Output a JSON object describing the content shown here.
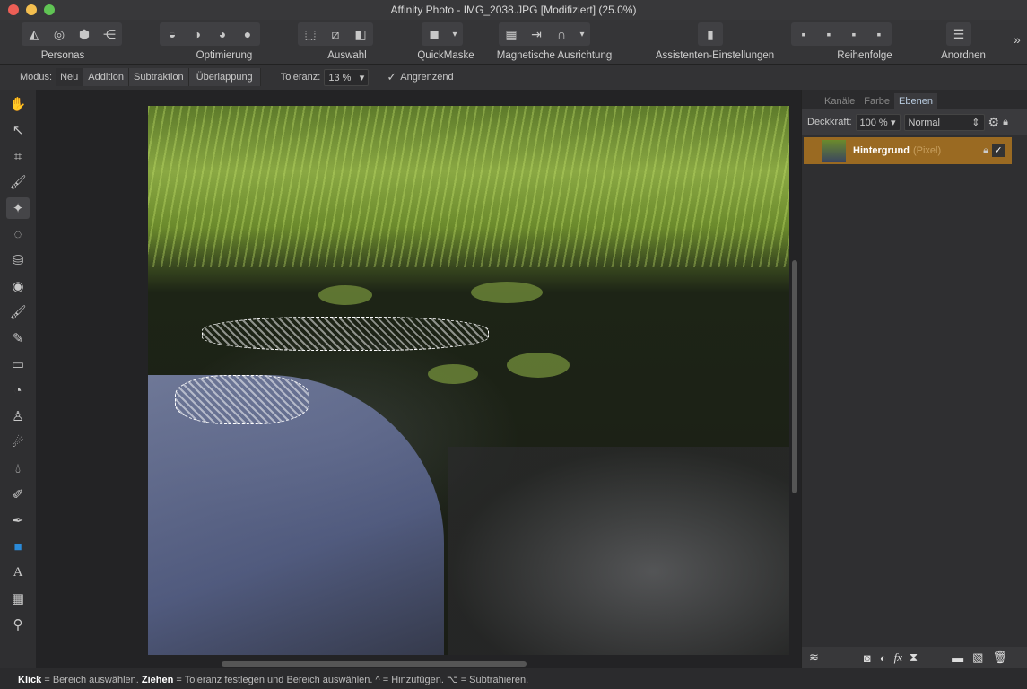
{
  "window": {
    "title": "Affinity Photo - IMG_2038.JPG [Modifiziert] (25.0%)"
  },
  "colors": {
    "accent": "#9a6a22",
    "tab_active": "#b9cce0",
    "close": "#ed5f56",
    "min": "#f4bf4f",
    "max": "#60c454"
  },
  "toolbar": {
    "groups": [
      {
        "label": "Personas",
        "icons": [
          "photo-persona-icon",
          "liquify-persona-icon",
          "develop-persona-icon",
          "export-persona-icon"
        ]
      },
      {
        "label": "Optimierung",
        "icons": [
          "auto-levels-icon",
          "auto-contrast-icon",
          "auto-colors-icon",
          "auto-white-balance-icon"
        ]
      },
      {
        "label": "Auswahl",
        "icons": [
          "select-all-icon",
          "deselect-icon",
          "invert-selection-icon"
        ]
      },
      {
        "label": "QuickMaske",
        "icons": [
          "quickmask-icon",
          "dropdown-icon"
        ]
      },
      {
        "label": "Magnetische Ausrichtung",
        "icons": [
          "snapping-grid-icon",
          "snapping-move-icon",
          "snapping-magnet-icon",
          "dropdown-icon"
        ]
      },
      {
        "label": "Assistenten-Einstellungen",
        "icons": [
          "assistant-icon"
        ]
      },
      {
        "label": "Reihenfolge",
        "icons": [
          "move-back-icon",
          "move-backward-icon",
          "move-forward-icon",
          "move-front-icon"
        ]
      },
      {
        "label": "Anordnen",
        "icons": [
          "align-icon"
        ]
      }
    ],
    "overflow": "»"
  },
  "context": {
    "mode_label": "Modus:",
    "modes": [
      "Neu",
      "Addition",
      "Subtraktion",
      "Überlappung"
    ],
    "tolerance_label": "Toleranz:",
    "tolerance_value": "13 %",
    "contiguous_label": "Angrenzend",
    "contiguous_checked": true
  },
  "tools": [
    "hand-tool",
    "move-tool",
    "crop-tool",
    "selection-brush-tool",
    "flood-select-tool",
    "marquee-tool",
    "fill-tool",
    "color-picker-tool",
    "paint-brush-tool",
    "color-replacement-tool",
    "erase-tool",
    "dodge-tool",
    "clone-tool",
    "smudge-tool",
    "blur-tool",
    "healing-tool",
    "pen-tool",
    "rectangle-tool",
    "text-tool",
    "mesh-warp-tool",
    "zoom-tool"
  ],
  "panel": {
    "tabs": [
      "Kanäle",
      "Farbe",
      "Ebenen"
    ],
    "active_tab": "Ebenen",
    "opacity_label": "Deckkraft:",
    "opacity_value": "100 %",
    "blend_mode": "Normal",
    "layers": [
      {
        "name": "Hintergrund",
        "type": "(Pixel)",
        "visible": true
      }
    ]
  },
  "status": {
    "k1": "Klick",
    "t1": " = Bereich auswählen. ",
    "k2": "Ziehen",
    "t2": " = Toleranz festlegen und Bereich auswählen. ^ = Hinzufügen. ⌥ = Subtrahieren."
  }
}
